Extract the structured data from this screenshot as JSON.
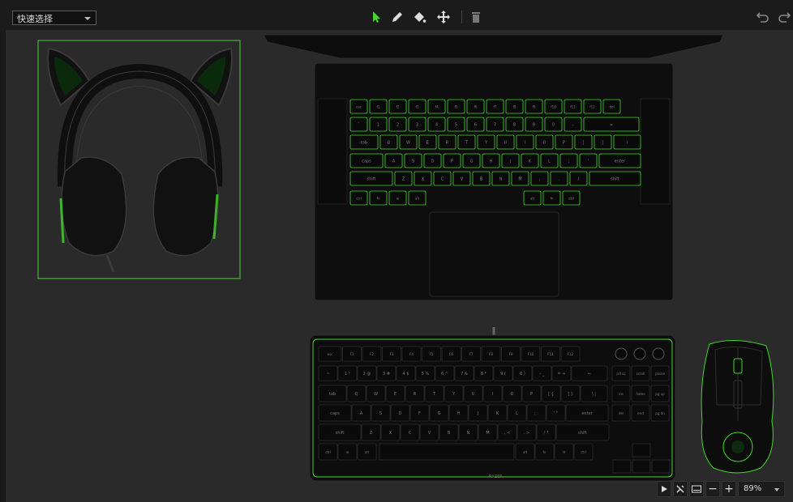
{
  "toolbar": {
    "mode_select": "快速选择",
    "tools": [
      "select-icon",
      "pen-icon",
      "fill-icon",
      "move-icon",
      "delete-icon"
    ],
    "undo": "undo-icon",
    "redo": "redo-icon"
  },
  "bottombar": {
    "zoom": "89%",
    "minus": "−",
    "plus": "+"
  },
  "laptop": {
    "row1": [
      "esc",
      "f1",
      "f2",
      "f3",
      "f4",
      "f5",
      "f6",
      "f7",
      "f8",
      "f9",
      "f10",
      "f11",
      "f12",
      "del"
    ],
    "row2": [
      "`",
      "1",
      "2",
      "3",
      "4",
      "5",
      "6",
      "7",
      "8",
      "9",
      "0",
      "-",
      "="
    ],
    "row3": [
      "tab",
      "Q",
      "W",
      "E",
      "R",
      "T",
      "Y",
      "U",
      "I",
      "O",
      "P",
      "[",
      "]",
      "\\"
    ],
    "row4": [
      "caps",
      "A",
      "S",
      "D",
      "F",
      "G",
      "H",
      "J",
      "K",
      "L",
      ";",
      "'",
      "enter"
    ],
    "row5": [
      "shift",
      "Z",
      "X",
      "C",
      "V",
      "B",
      "N",
      "M",
      ",",
      ".",
      "/",
      "shift"
    ],
    "row6": [
      "ctrl",
      "fn",
      "⊞",
      "alt",
      "alt",
      "fn",
      "ctrl"
    ]
  },
  "keyboard": {
    "fn_row": [
      "esc",
      "F1",
      "F2",
      "F3",
      "F4",
      "F5",
      "F6",
      "F7",
      "F8",
      "F9",
      "F10",
      "F11",
      "F12"
    ],
    "num_row": [
      "~",
      "1 !",
      "2 @",
      "3 #",
      "4 $",
      "5 %",
      "6 ^",
      "7 &",
      "8 *",
      "9 (",
      "0 )",
      "- _",
      "= +",
      "←"
    ],
    "q_row": [
      "tab",
      "Q",
      "W",
      "E",
      "R",
      "T",
      "Y",
      "U",
      "I",
      "O",
      "P",
      "[ {",
      "] }",
      "\\ |"
    ],
    "a_row": [
      "caps",
      "A",
      "S",
      "D",
      "F",
      "G",
      "H",
      "J",
      "K",
      "L",
      "; :",
      "' \"",
      "enter"
    ],
    "z_row": [
      "shift",
      "Z",
      "X",
      "C",
      "V",
      "B",
      "N",
      "M",
      ", <",
      ". >",
      "/ ?",
      "shift"
    ],
    "bottom_row": [
      "ctrl",
      "⊞",
      "alt",
      "alt",
      "fn",
      "☰",
      "ctrl"
    ],
    "nav_top": [
      "prt sc",
      "scroll",
      "pause"
    ],
    "nav_mid": [
      "ins",
      "home",
      "pg up"
    ],
    "nav_low": [
      "del",
      "end",
      "pg dn"
    ],
    "brand": "RAZER"
  },
  "colors": {
    "accent": "#44d62c",
    "canvas": "#2a2a2a",
    "device": "#0d0d0d"
  }
}
